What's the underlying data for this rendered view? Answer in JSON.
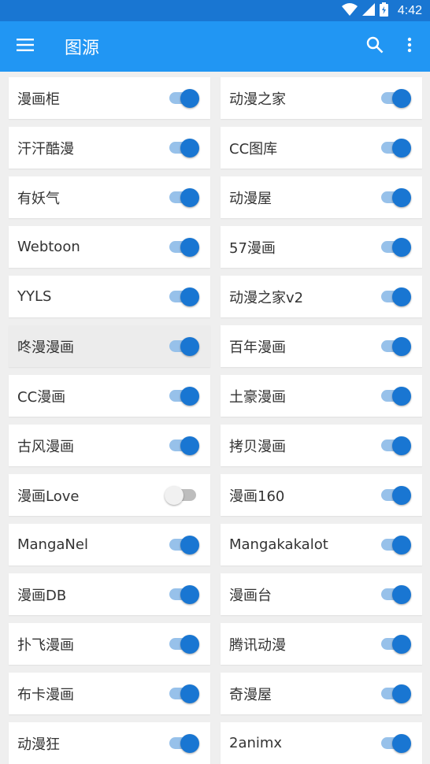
{
  "status_bar": {
    "time": "4:42"
  },
  "app_bar": {
    "title": "图源"
  },
  "colors": {
    "status_bar": "#1976d2",
    "app_bar": "#2196f3",
    "switch_on_thumb": "#1976d2",
    "switch_on_track": "#97c1ea",
    "switch_off_thumb": "#f1f1f1",
    "switch_off_track": "#bdbdbd"
  },
  "icons": {
    "menu": "menu-icon",
    "search": "search-icon",
    "more": "more-vert-icon",
    "wifi": "wifi-icon",
    "signal": "signal-icon",
    "battery": "battery-icon"
  },
  "sources": [
    {
      "label": "漫画柜",
      "enabled": true
    },
    {
      "label": "动漫之家",
      "enabled": true
    },
    {
      "label": "汗汗酷漫",
      "enabled": true
    },
    {
      "label": "CC图库",
      "enabled": true
    },
    {
      "label": "有妖气",
      "enabled": true
    },
    {
      "label": "动漫屋",
      "enabled": true
    },
    {
      "label": "Webtoon",
      "enabled": true
    },
    {
      "label": "57漫画",
      "enabled": true
    },
    {
      "label": "YYLS",
      "enabled": true
    },
    {
      "label": "动漫之家v2",
      "enabled": true
    },
    {
      "label": "咚漫漫画",
      "enabled": true,
      "pressed": true
    },
    {
      "label": "百年漫画",
      "enabled": true
    },
    {
      "label": "CC漫画",
      "enabled": true
    },
    {
      "label": "土豪漫画",
      "enabled": true
    },
    {
      "label": "古风漫画",
      "enabled": true
    },
    {
      "label": "拷贝漫画",
      "enabled": true
    },
    {
      "label": "漫画Love",
      "enabled": false
    },
    {
      "label": "漫画160",
      "enabled": true
    },
    {
      "label": "MangaNel",
      "enabled": true
    },
    {
      "label": "Mangakakalot",
      "enabled": true
    },
    {
      "label": "漫画DB",
      "enabled": true
    },
    {
      "label": "漫画台",
      "enabled": true
    },
    {
      "label": "扑飞漫画",
      "enabled": true
    },
    {
      "label": "腾讯动漫",
      "enabled": true
    },
    {
      "label": "布卡漫画",
      "enabled": true
    },
    {
      "label": "奇漫屋",
      "enabled": true
    },
    {
      "label": "动漫狂",
      "enabled": true
    },
    {
      "label": "2animx",
      "enabled": true
    }
  ]
}
